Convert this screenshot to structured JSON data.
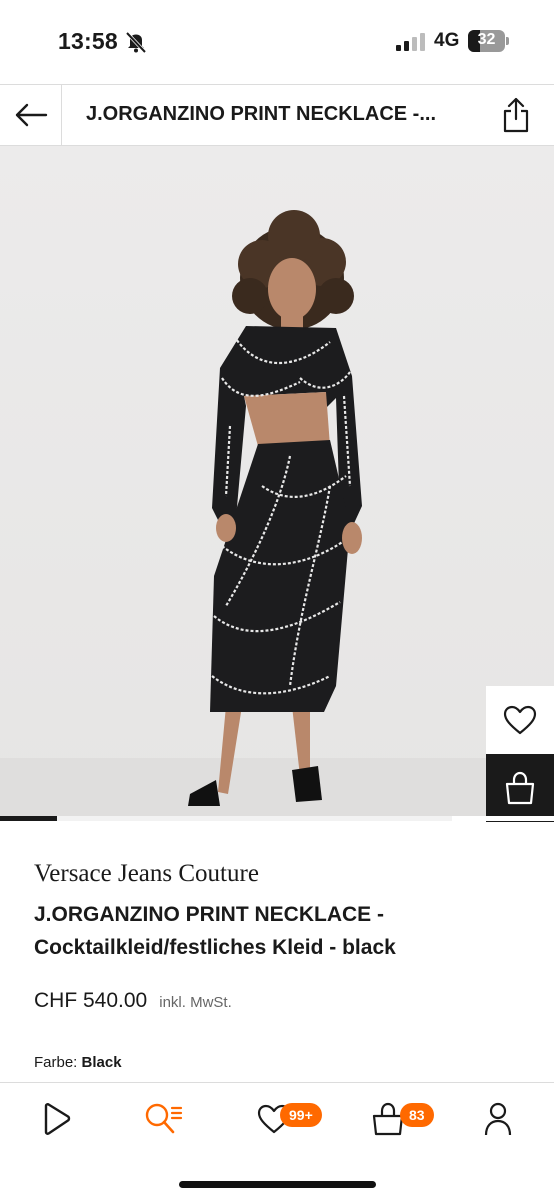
{
  "status_bar": {
    "time": "13:58",
    "network": "4G",
    "battery": "32",
    "icons": [
      "bell-slash-icon",
      "signal-icon",
      "battery-icon"
    ]
  },
  "header": {
    "title": "J.ORGANZINO PRINT NECKLACE -...",
    "icons": [
      "back-arrow-icon",
      "share-icon"
    ]
  },
  "gallery": {
    "image_index": 1,
    "image_count": 8,
    "actions": [
      "heart-icon",
      "bag-icon"
    ]
  },
  "product": {
    "brand": "Versace Jeans Couture",
    "name": "J.ORGANZINO PRINT NECKLACE - Cocktailkleid/festliches Kleid - black",
    "price": "CHF 540.00",
    "tax_note": "inkl. MwSt.",
    "color_label": "Farbe:",
    "color_value": "Black"
  },
  "bottom_nav": {
    "items": [
      {
        "icon": "home-icon"
      },
      {
        "icon": "search-icon",
        "active": true
      },
      {
        "icon": "heart-icon",
        "badge": "99+"
      },
      {
        "icon": "bag-icon",
        "badge": "83"
      },
      {
        "icon": "profile-icon"
      }
    ]
  },
  "colors": {
    "accent": "#ff6900",
    "text": "#1a1a1a",
    "border": "#dcdcdc"
  }
}
